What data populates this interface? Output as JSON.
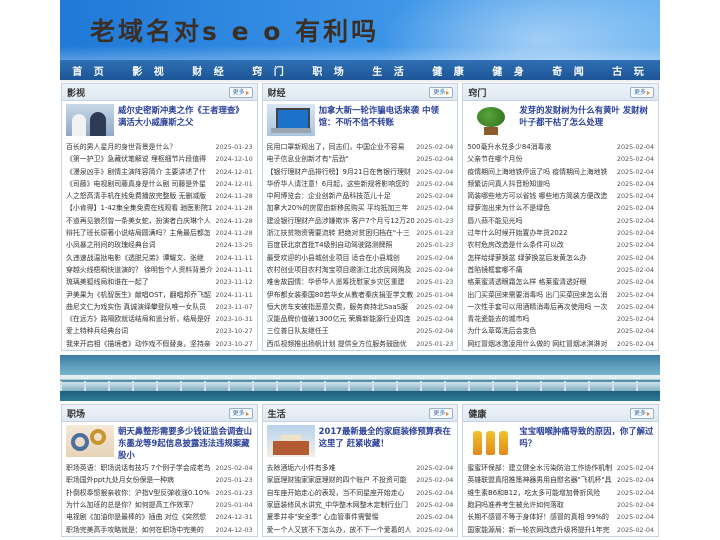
{
  "site": {
    "title": "老域名对s e o 有利吗"
  },
  "nav": [
    "首 页",
    "影 视",
    "财 经",
    "窍 门",
    "职 场",
    "生 活",
    "健 康",
    "健 身",
    "奇 闻",
    "古 玩"
  ],
  "more_label": "更多",
  "top_boxes": [
    {
      "category": "影视",
      "thumb": "people-thumbnail",
      "feature": "威尔史密斯冲奥之作《王者理查》 满活大小威廉斯之父",
      "items": [
        {
          "t": "百长的男人星月的身世背景是什么？",
          "d": "2025-01-23"
        },
        {
          "t": "《第一护卫》急藏伏笔解说 埋枢细节片段值得",
          "d": "2024-12-10"
        },
        {
          "t": "《漫泉凶手》剧情主演阵容简介 主要讲述了什",
          "d": "2024-12-01"
        },
        {
          "t": "《司藤》电视剧司藤真身是什么剧 司藤是外星",
          "d": "2024-12-01"
        },
        {
          "t": "人之怒高清手机在线免费播放完整版 无删减版",
          "d": "2024-11-28"
        },
        {
          "t": "【小肯得】1-42集全集免费在线观看 驰医影院1",
          "d": "2024-11-28"
        },
        {
          "t": "不道再见狼烈曾一条美女蛇，扮演者白庆琳个人",
          "d": "2024-11-28"
        },
        {
          "t": "辩托了班长原著小说结局圆满吗？主角最后都怎",
          "d": "2024-11-28"
        },
        {
          "t": "小凤暴之刑间的玫瑰经典台词",
          "d": "2024-13-25"
        },
        {
          "t": "久违速战温挞电影《透脱兄弟》谭耀文、张继",
          "d": "2024-11-11"
        },
        {
          "t": "穿越火线梧桐快道演的？ 徐明哲个人资料背景介",
          "d": "2024-11-11"
        },
        {
          "t": "琉璃美狐线局和谁在一起了",
          "d": "2023-11-12"
        },
        {
          "t": "尹美果为《机智医生》献唱OST，翻唱邦乔飞韶",
          "d": "2024-11-11"
        },
        {
          "t": "曲尼文仁为戏实伤 真诚演绎攀登队唯一女队员",
          "d": "2023-11-07"
        },
        {
          "t": "《在远方》路隔欧就话结局和遥分析，结局是好",
          "d": "2023-10-31"
        },
        {
          "t": "爱上特种兵经典台词",
          "d": "2023-10-27"
        },
        {
          "t": "我来开启相《描境者》动作戏不假替身，坚持亲",
          "d": "2023-10-27"
        }
      ]
    },
    {
      "category": "财经",
      "thumb": "laptop-thumbnail",
      "feature": "加拿大新一轮诈骗电话来袭 中领馆：不听不信不转账",
      "items": [
        {
          "t": "民用口罩新规出了，同志们，中国企业不容易",
          "d": "2025-02-04"
        },
        {
          "t": "电子信息业创新才有\"后劲\"",
          "d": "2025-02-04"
        },
        {
          "t": "【银行理财产品排行榜】9月21日在售银行理财",
          "d": "2025-02-04"
        },
        {
          "t": "华侨华人请注意！6月起，这些新规将影响您的",
          "d": "2025-02-04"
        },
        {
          "t": "中阿博览会：企业创新产品科技范儿十足",
          "d": "2025-02-04"
        },
        {
          "t": "加拿大20%的房屋由新移民购买 平均抵加三年",
          "d": "2025-02-04"
        },
        {
          "t": "建设银行理财产品涉嫌欺诈 客户7个月亏12万20",
          "d": "2025-01-23"
        },
        {
          "t": "浙江扶贫物资需要流转 把绝对贫困归档在\"十三",
          "d": "2025-01-23"
        },
        {
          "t": "百度获北京首批T4级别自动驾驶路测牌照",
          "d": "2025-01-23"
        },
        {
          "t": "最受欢迎的小县城创业项目 适合在小县城创",
          "d": "2025-02-04"
        },
        {
          "t": "农村创业项目农村淘宝项目邀浙江北农民网购及",
          "d": "2025-02-04"
        },
        {
          "t": "难舍故园情：华侨华人遥筹抚慰家乡灾区重建",
          "d": "2025-01-23"
        },
        {
          "t": "伊布都女装秦国80若华女从教者秦庆捐亚学文教",
          "d": "2025-01-04"
        },
        {
          "t": "恒大房车安被指恶意欠费，服务商持北SaaS服",
          "d": "2025-02-04"
        },
        {
          "t": "汉能品牌价值破1300亿元 荣膺新能源行业四连",
          "d": "2025-02-04"
        },
        {
          "t": "三位普日队友继任王",
          "d": "2025-02-04"
        },
        {
          "t": "西瓜视频推出扬帆计划 提供全方位服务鼓励优",
          "d": "2025-01-23"
        }
      ]
    },
    {
      "category": "窍门",
      "thumb": "tree-thumbnail",
      "feature": "发芽的发财树为什么有黄叶 发财树叶子都干枯了怎么处理",
      "items": [
        {
          "t": "500毫升水兑多少84消毒液",
          "d": "2025-02-04"
        },
        {
          "t": "父亲节在哪个月份",
          "d": "2025-02-04"
        },
        {
          "t": "疫情期间上海地铁停运了吗 疫情期间上海地铁",
          "d": "2025-02-04"
        },
        {
          "t": "频繁访问真人抖音粉知道吗",
          "d": "2025-02-04"
        },
        {
          "t": "简装哪些地方可以省钱 哪些地方简装方便改造",
          "d": "2025-02-04"
        },
        {
          "t": "绿萝泡出来为什么不是绿色",
          "d": "2025-02-04"
        },
        {
          "t": "唇八蒜不能见光吗",
          "d": "2025-02-04"
        },
        {
          "t": "过年什么时候开始置办年货2022",
          "d": "2025-02-04"
        },
        {
          "t": "农村危房改造是什么条件可以改",
          "d": "2025-02-04"
        },
        {
          "t": "怎样给绿萝换盆 绿萝换盆后发黄怎么办",
          "d": "2025-02-04"
        },
        {
          "t": "首陷镜框套哪不痛",
          "d": "2025-02-04"
        },
        {
          "t": "格莱蜜清透眼霜怎么样 格莱蜜清透好眼",
          "d": "2025-02-04"
        },
        {
          "t": "出门买菜回来需要消毒吗 出门买菜回来怎么消",
          "d": "2025-02-04"
        },
        {
          "t": "一次性手套可以用酒精消毒后再次使用吗 一次",
          "d": "2025-02-04"
        },
        {
          "t": "青花瓷能去的城市吗",
          "d": "2025-02-04"
        },
        {
          "t": "为什么草莓洗后会变色",
          "d": "2025-02-04"
        },
        {
          "t": "网红冒烟冰激凌用什么做的 网红冒烟冰淇淋对",
          "d": "2025-02-04"
        }
      ]
    }
  ],
  "bottom_boxes": [
    {
      "category": "职场",
      "thumb": "gear-thumbnail",
      "feature": "朝天鼻整形需要多少钱证监会调查山东墨龙等9起信息披露违法违规案藏股小",
      "items": [
        {
          "t": "职场英语：职场说话有技巧 7个例子学会成老鸟",
          "d": "2025-02-04"
        },
        {
          "t": "职场国外ppt九处月女份保是一种病",
          "d": "2025-01-23"
        },
        {
          "t": "扑倒权奉惯狠亲收你：沪指V型反弹收涨0.10%",
          "d": "2025-01-23"
        },
        {
          "t": "为什么加班的总是你？如何提高工作效率？",
          "d": "2025-01-04"
        },
        {
          "t": "电视剧《加油你是最棒的》插曲 对位《突然想",
          "d": "2024-12-31"
        },
        {
          "t": "职场完美高手攻略就是：如何在职场中完美的",
          "d": "2024-12-03"
        }
      ]
    },
    {
      "category": "生活",
      "thumb": "house-thumbnail",
      "feature": "2017最新最全的家庭装修预算表在这里了 赶紧收藏！",
      "items": [
        {
          "t": "去除酒垢六小件有多难",
          "d": "2025-02-04"
        },
        {
          "t": "家庭理财独家家庭理财的四个账户 不投资可能",
          "d": "2025-02-04"
        },
        {
          "t": "自车座开始走心的表现，当不同星座开始走心",
          "d": "2025-02-04"
        },
        {
          "t": "家庭装修风水讲究_中华整木网整木定制行业门",
          "d": "2025-02-04"
        },
        {
          "t": "夏季并非\"安全季\" 心血管事件需警惕",
          "d": "2025-02-04"
        },
        {
          "t": "爱一个人又放不下怎么办，放不下一个爱着的人",
          "d": "2025-02-04"
        }
      ]
    },
    {
      "category": "健康",
      "thumb": "bottles-thumbnail",
      "feature": "宝宝咽喉肿痛导致的原因，你了解过吗？",
      "items": [
        {
          "t": "蜜蜜环保部：建立健全水污染防治工作协作机制",
          "d": "2025-02-04"
        },
        {
          "t": "英雄联盟真阳推策神器男用自慰名器\"飞机杯\"具",
          "d": "2025-02-04"
        },
        {
          "t": "维生素B6和B12，吃太多可能增加骨折风险",
          "d": "2025-02-04"
        },
        {
          "t": "跑洞吗准养考生被允许如何落取",
          "d": "2025-02-04"
        },
        {
          "t": "长期不感冒不等于身体好！感冒的真相 99%的",
          "d": "2025-02-04"
        },
        {
          "t": "国家能源局：新一轮农网改造升级将提升1年完",
          "d": "2025-02-04"
        }
      ]
    }
  ]
}
